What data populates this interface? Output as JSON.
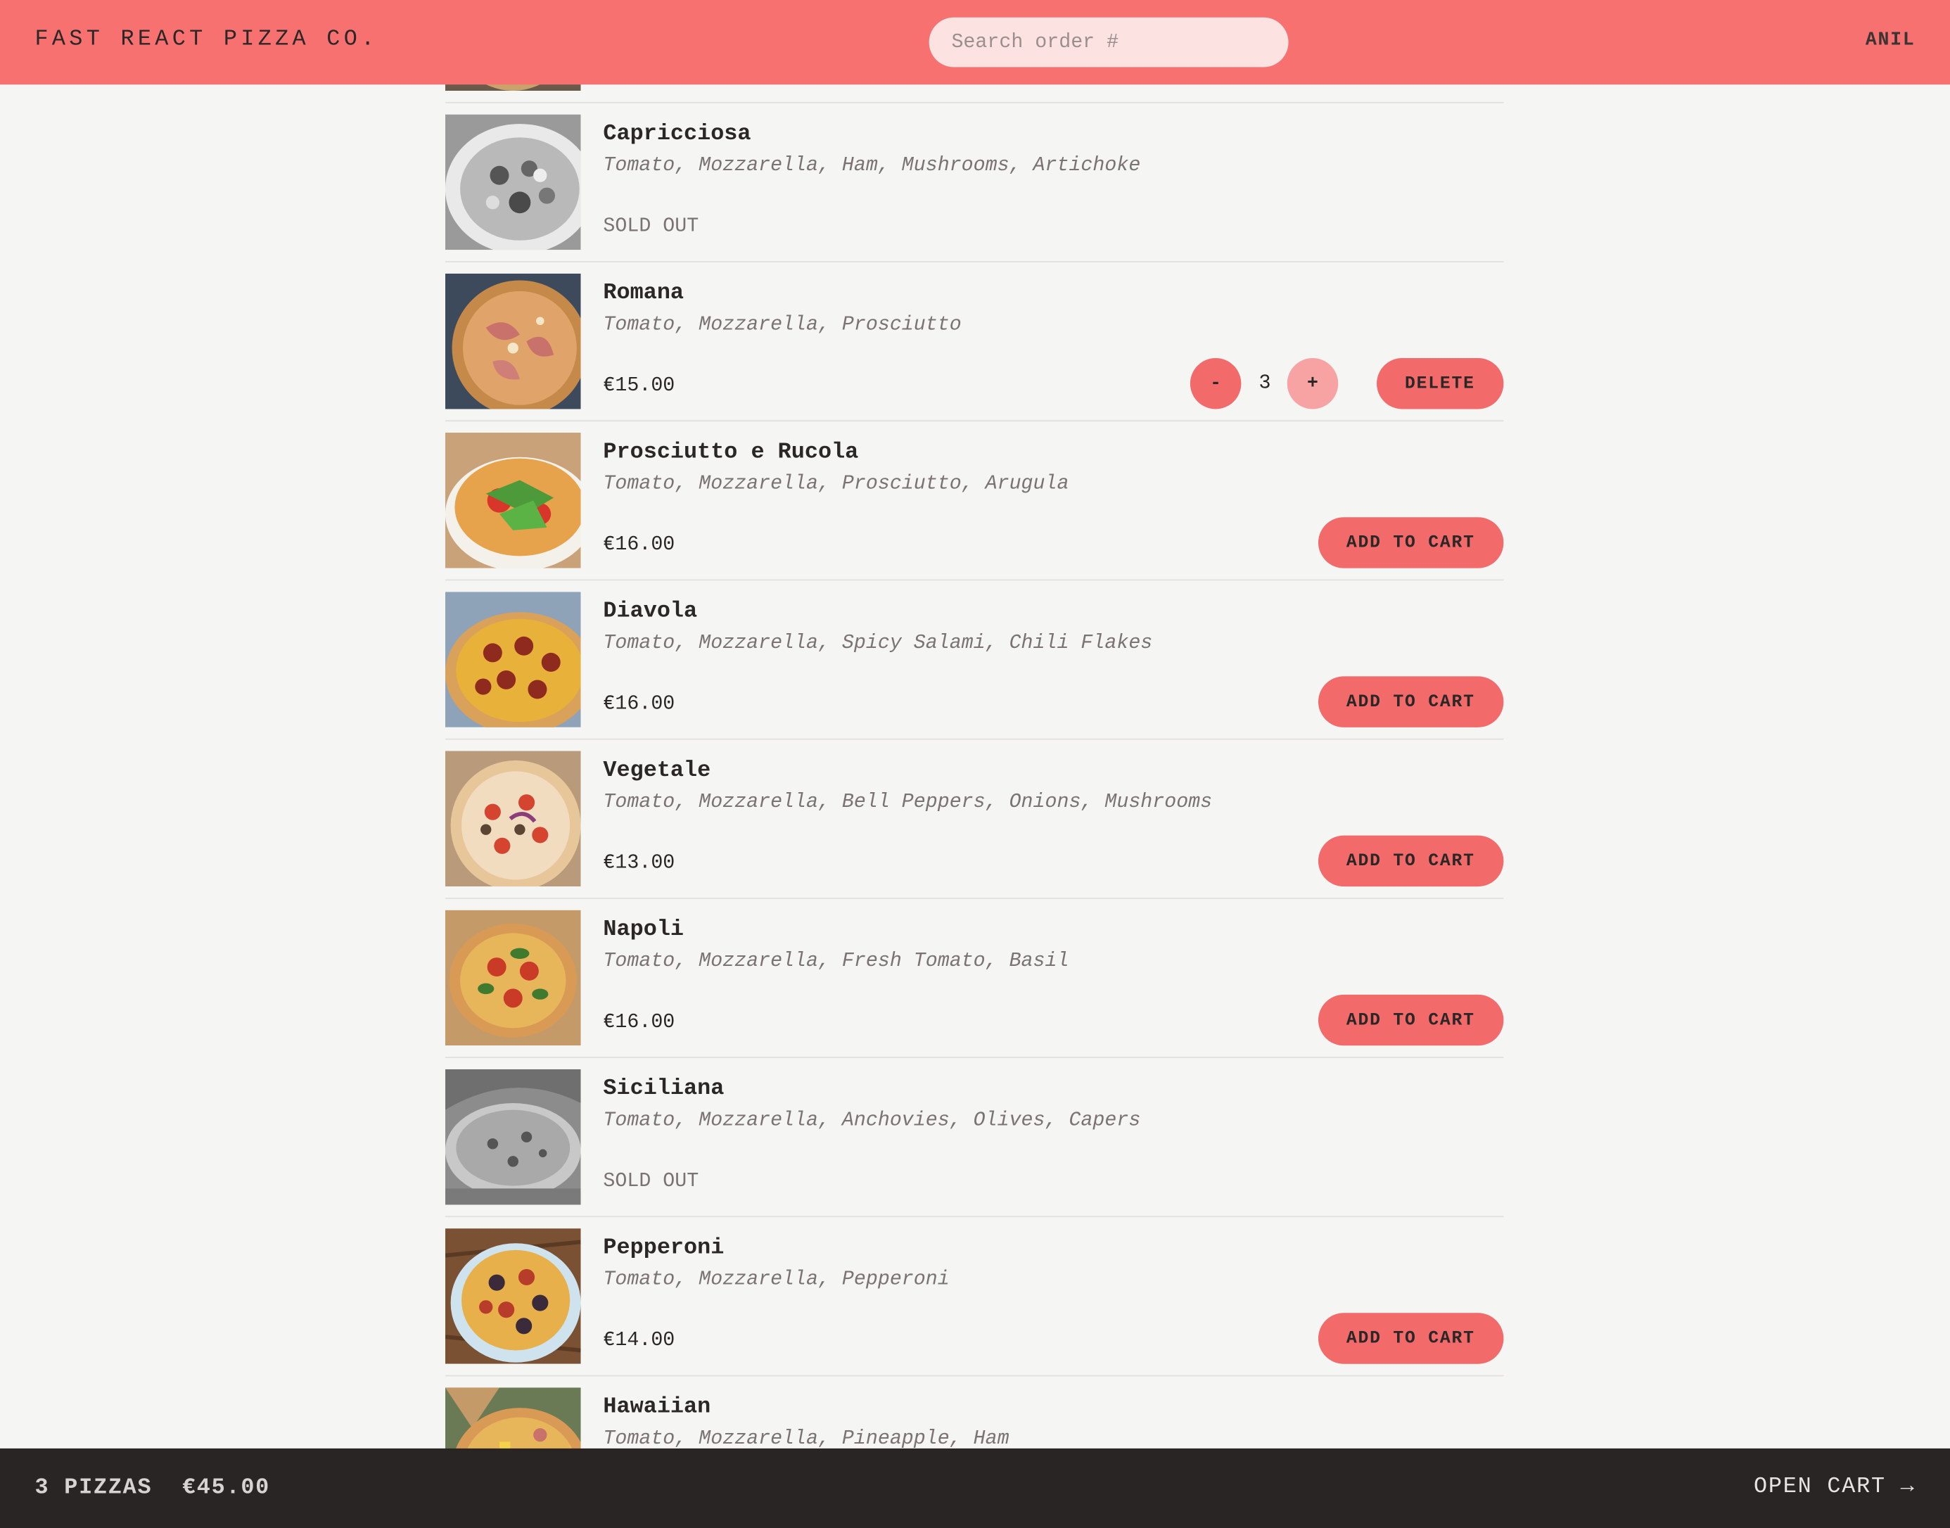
{
  "header": {
    "logo": "FAST REACT PIZZA CO.",
    "search_placeholder": "Search order #",
    "username": "ANIL"
  },
  "menu": [
    {
      "name": "Capricciosa",
      "ingredients": "Tomato, Mozzarella, Ham, Mushrooms, Artichoke",
      "price": "SOLD OUT",
      "sold_out": true,
      "image": "capricciosa-pizza-image"
    },
    {
      "name": "Romana",
      "ingredients": "Tomato, Mozzarella, Prosciutto",
      "price": "€15.00",
      "sold_out": false,
      "in_cart": true,
      "quantity": "3",
      "minus_label": "-",
      "plus_label": "+",
      "delete_label": "DELETE",
      "image": "romana-pizza-image"
    },
    {
      "name": "Prosciutto e Rucola",
      "ingredients": "Tomato, Mozzarella, Prosciutto, Arugula",
      "price": "€16.00",
      "sold_out": false,
      "button": "ADD TO CART",
      "image": "prosciutto-rucola-pizza-image"
    },
    {
      "name": "Diavola",
      "ingredients": "Tomato, Mozzarella, Spicy Salami, Chili Flakes",
      "price": "€16.00",
      "sold_out": false,
      "button": "ADD TO CART",
      "image": "diavola-pizza-image"
    },
    {
      "name": "Vegetale",
      "ingredients": "Tomato, Mozzarella, Bell Peppers, Onions, Mushrooms",
      "price": "€13.00",
      "sold_out": false,
      "button": "ADD TO CART",
      "image": "vegetale-pizza-image"
    },
    {
      "name": "Napoli",
      "ingredients": "Tomato, Mozzarella, Fresh Tomato, Basil",
      "price": "€16.00",
      "sold_out": false,
      "button": "ADD TO CART",
      "image": "napoli-pizza-image"
    },
    {
      "name": "Siciliana",
      "ingredients": "Tomato, Mozzarella, Anchovies, Olives, Capers",
      "price": "SOLD OUT",
      "sold_out": true,
      "image": "siciliana-pizza-image"
    },
    {
      "name": "Pepperoni",
      "ingredients": "Tomato, Mozzarella, Pepperoni",
      "price": "€14.00",
      "sold_out": false,
      "button": "ADD TO CART",
      "image": "pepperoni-pizza-image"
    },
    {
      "name": "Hawaiian",
      "ingredients": "Tomato, Mozzarella, Pineapple, Ham",
      "image": "hawaiian-pizza-image"
    }
  ],
  "cart": {
    "count": "3 PIZZAS",
    "total": "€45.00",
    "open_label": "OPEN CART →"
  },
  "colors": {
    "accent": "#f87171",
    "button": "#f26a6a",
    "footer": "#292524",
    "background": "#f5f5f3"
  }
}
